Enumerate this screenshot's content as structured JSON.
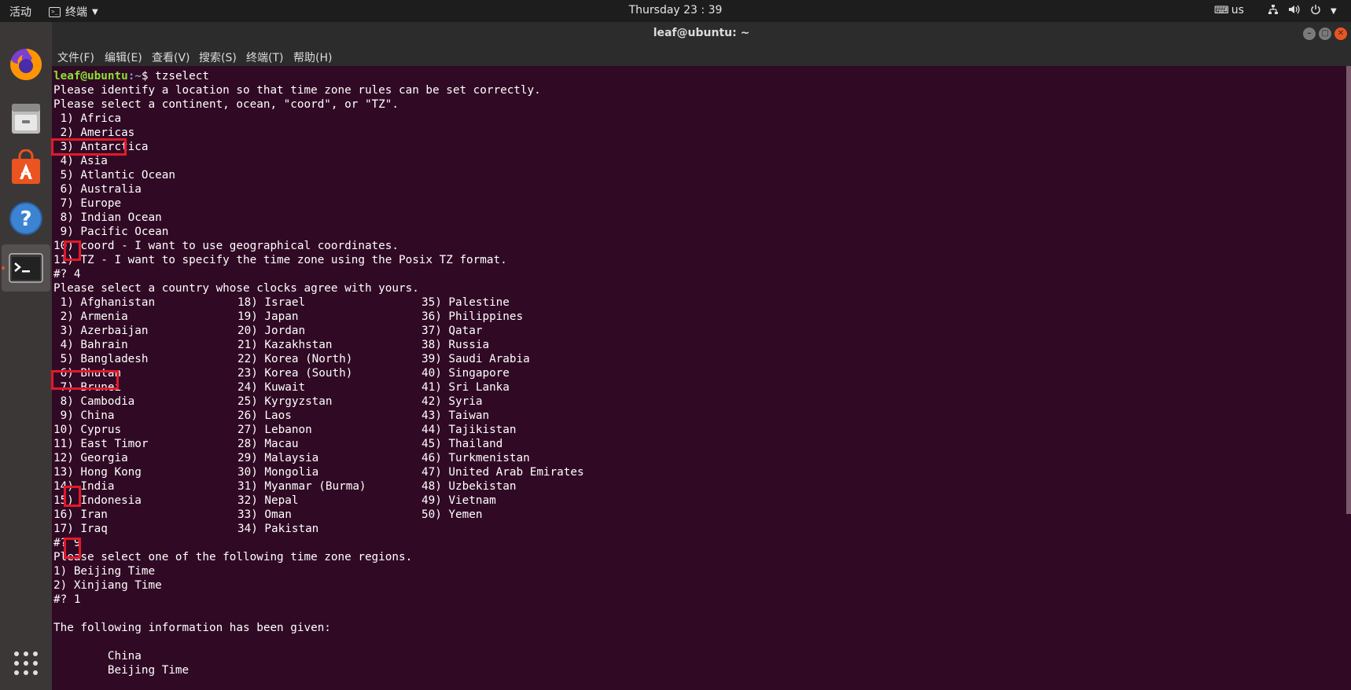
{
  "topbar": {
    "activities": "活动",
    "app_name": "终端",
    "clock": "Thursday 23 : 39",
    "keyboard_layout": "us"
  },
  "dock": {
    "items": [
      {
        "icon": "firefox-icon"
      },
      {
        "icon": "files-icon"
      },
      {
        "icon": "software-center-icon"
      },
      {
        "icon": "help-icon"
      },
      {
        "icon": "terminal-icon"
      },
      {
        "icon": "show-applications-icon"
      }
    ]
  },
  "window": {
    "title": "leaf@ubuntu: ~",
    "menu": [
      "文件(F)",
      "编辑(E)",
      "查看(V)",
      "搜索(S)",
      "终端(T)",
      "帮助(H)"
    ]
  },
  "terminal": {
    "prompt_user": "leaf@ubuntu",
    "prompt_dir": ":~",
    "prompt_suffix": "$ tzselect",
    "intro": [
      "Please identify a location so that time zone rules can be set correctly.",
      "Please select a continent, ocean, \"coord\", or \"TZ\"."
    ],
    "continents": [
      " 1) Africa",
      " 2) Americas",
      " 3) Antarctica",
      " 4) Asia",
      " 5) Atlantic Ocean",
      " 6) Australia",
      " 7) Europe",
      " 8) Indian Ocean",
      " 9) Pacific Ocean",
      "10) coord - I want to use geographical coordinates.",
      "11) TZ - I want to specify the time zone using the Posix TZ format."
    ],
    "answer1": "#? 4",
    "country_prompt": "Please select a country whose clocks agree with yours.",
    "countries": [
      [
        " 1) Afghanistan",
        "18) Israel",
        "35) Palestine"
      ],
      [
        " 2) Armenia",
        "19) Japan",
        "36) Philippines"
      ],
      [
        " 3) Azerbaijan",
        "20) Jordan",
        "37) Qatar"
      ],
      [
        " 4) Bahrain",
        "21) Kazakhstan",
        "38) Russia"
      ],
      [
        " 5) Bangladesh",
        "22) Korea (North)",
        "39) Saudi Arabia"
      ],
      [
        " 6) Bhutan",
        "23) Korea (South)",
        "40) Singapore"
      ],
      [
        " 7) Brunei",
        "24) Kuwait",
        "41) Sri Lanka"
      ],
      [
        " 8) Cambodia",
        "25) Kyrgyzstan",
        "42) Syria"
      ],
      [
        " 9) China",
        "26) Laos",
        "43) Taiwan"
      ],
      [
        "10) Cyprus",
        "27) Lebanon",
        "44) Tajikistan"
      ],
      [
        "11) East Timor",
        "28) Macau",
        "45) Thailand"
      ],
      [
        "12) Georgia",
        "29) Malaysia",
        "46) Turkmenistan"
      ],
      [
        "13) Hong Kong",
        "30) Mongolia",
        "47) United Arab Emirates"
      ],
      [
        "14) India",
        "31) Myanmar (Burma)",
        "48) Uzbekistan"
      ],
      [
        "15) Indonesia",
        "32) Nepal",
        "49) Vietnam"
      ],
      [
        "16) Iran",
        "33) Oman",
        "50) Yemen"
      ],
      [
        "17) Iraq",
        "34) Pakistan",
        ""
      ]
    ],
    "answer2": "#? 9",
    "region_prompt": "Please select one of the following time zone regions.",
    "regions": [
      "1) Beijing Time",
      "2) Xinjiang Time"
    ],
    "answer3": "#? 1",
    "blank": "",
    "info_header": "The following information has been given:",
    "blank2": "",
    "info_lines": [
      "        China",
      "        Beijing Time"
    ]
  }
}
